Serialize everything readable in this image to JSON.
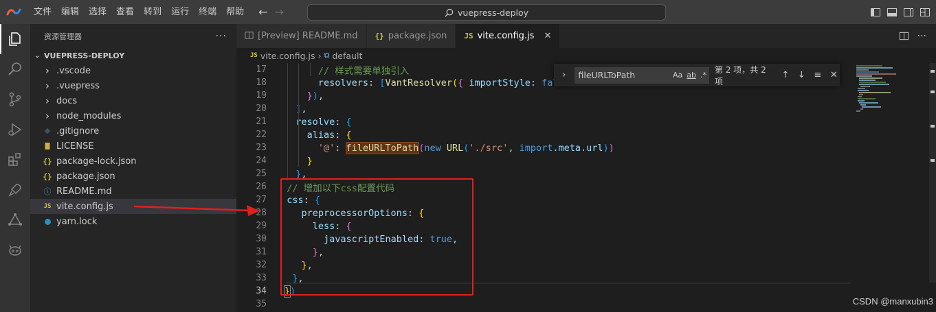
{
  "menu": [
    "文件",
    "编辑",
    "选择",
    "查看",
    "转到",
    "运行",
    "终端",
    "帮助"
  ],
  "search_text": "vuepress-deploy",
  "sidebar": {
    "title": "资源管理器",
    "more": "···",
    "section": "VUEPRESS-DEPLOY",
    "items": [
      {
        "label": ".vscode",
        "icon": "chevron-right-icon"
      },
      {
        "label": ".vuepress",
        "icon": "chevron-right-icon"
      },
      {
        "label": "docs",
        "icon": "chevron-right-icon"
      },
      {
        "label": "node_modules",
        "icon": "chevron-right-icon"
      },
      {
        "label": ".gitignore",
        "icon": "git-diamond-icon"
      },
      {
        "label": "LICENSE",
        "icon": "license-icon"
      },
      {
        "label": "package-lock.json",
        "icon": "json-braces-icon"
      },
      {
        "label": "package.json",
        "icon": "json-braces-icon"
      },
      {
        "label": "README.md",
        "icon": "info-icon"
      },
      {
        "label": "vite.config.js",
        "icon": "js-icon"
      },
      {
        "label": "yarn.lock",
        "icon": "yarn-icon"
      }
    ],
    "js_badge": "JS",
    "json_badge": "{}",
    "info_badge": "ⓘ"
  },
  "tabs": [
    {
      "label": "[Preview] README.md"
    },
    {
      "label": "package.json"
    },
    {
      "label": "vite.config.js"
    }
  ],
  "breadcrumb": {
    "file": "vite.config.js",
    "symbol": "default",
    "sep": "›"
  },
  "find": {
    "query": "fileURLToPath",
    "case": "Aa",
    "word": "ab",
    "regex": ".*",
    "count": "第 2 项，共 2 项"
  },
  "code_lines": [
    {
      "n": "17",
      "html": "<span class='c-com'>// 样式需要单独引入</span>",
      "indent": 3
    },
    {
      "n": "18",
      "html": "<span class='c-prop'>resolvers</span><span class='c-punc'>: </span><span class='c-p3'>[</span><span class='c-fn'>VantResolver</span><span class='c-p1'>(</span><span class='c-p2'>{</span> <span class='c-prop'>importStyle</span><span class='c-punc'>: </span><span class='c-kw'>fal</span>",
      "indent": 3
    },
    {
      "n": "19",
      "html": "<span class='c-p2'>}</span><span class='c-p3'>)</span><span class='c-punc'>,</span>",
      "indent": 2
    },
    {
      "n": "20",
      "html": "<span class='c-p3'>]</span><span class='c-punc'>,</span>",
      "indent": 1
    },
    {
      "n": "21",
      "html": "<span class='c-prop'>resolve</span><span class='c-punc'>: </span><span class='c-p3'>{</span>",
      "indent": 1
    },
    {
      "n": "22",
      "html": "<span class='c-prop'>alias</span><span class='c-punc'>: </span><span class='c-p1'>{</span>",
      "indent": 2
    },
    {
      "n": "23",
      "html": "<span class='c-str'>'@'</span><span class='c-punc'>: </span><span class='c-fn hl-find'>fileURLToPath</span><span class='c-p2'>(</span><span class='c-kw'>new</span> <span class='c-fn'>URL</span><span class='c-p3'>(</span><span class='c-str'>'./src'</span><span class='c-punc'>, </span><span class='c-kw'>import</span><span class='c-punc'>.</span><span class='c-prop'>meta</span><span class='c-punc'>.</span><span class='c-prop'>url</span><span class='c-p3'>)</span><span class='c-p2'>)</span>",
      "indent": 3
    },
    {
      "n": "24",
      "html": "<span class='c-p1'>}</span>",
      "indent": 2
    },
    {
      "n": "25",
      "html": "<span class='c-p3'>}</span><span class='c-punc'>,</span>",
      "indent": 1
    },
    {
      "n": "26",
      "html": "<span class='c-com'>// 增加以下css配置代码</span>",
      "indent": 0.2
    },
    {
      "n": "27",
      "html": "<span class='c-prop'>css</span><span class='c-punc'>: </span><span class='c-p3'>{</span>",
      "indent": 0.2
    },
    {
      "n": "28",
      "html": "<span class='c-prop'>preprocessorOptions</span><span class='c-punc'>: </span><span class='c-p1'>{</span>",
      "indent": 1.5
    },
    {
      "n": "29",
      "html": "<span class='c-prop'>less</span><span class='c-punc'>: </span><span class='c-p2'>{</span>",
      "indent": 2.5
    },
    {
      "n": "30",
      "html": "<span class='c-prop'>javascriptEnabled</span><span class='c-punc'>: </span><span class='c-kw'>true</span><span class='c-punc'>,</span>",
      "indent": 3.5
    },
    {
      "n": "31",
      "html": "<span class='c-p2'>}</span><span class='c-punc'>,</span>",
      "indent": 2.5
    },
    {
      "n": "32",
      "html": "<span class='c-p1'>}</span><span class='c-punc'>,</span>",
      "indent": 1.5
    },
    {
      "n": "33",
      "html": "<span class='c-p3'>}</span><span class='c-punc'>,</span>",
      "indent": 0.7
    },
    {
      "n": "34",
      "html": "<span class='c-p1 cursor-br'>}</span><span class='c-p3'>)</span>",
      "indent": 0
    },
    {
      "n": "35",
      "html": "",
      "indent": 0
    }
  ],
  "current_line": "34",
  "watermark": "CSDN @manxubin3",
  "colors": {
    "accent_red": "#e02020",
    "find_highlight": "#613214"
  }
}
